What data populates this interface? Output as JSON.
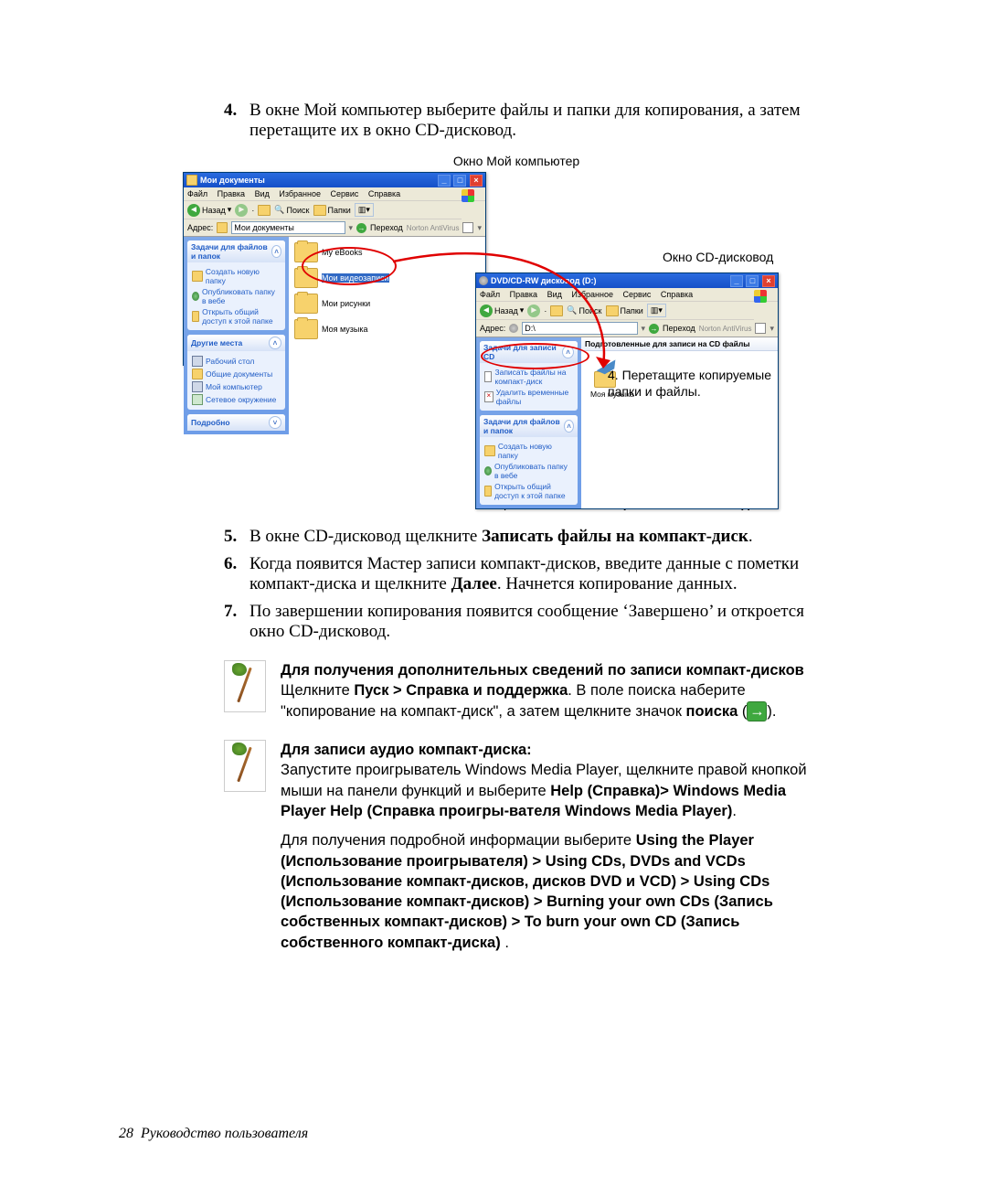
{
  "steps": {
    "s4_num": "4.",
    "s4_text": "В окне Мой компьютер выберите файлы и папки для копирования, а затем перетащите их в окно CD-дисковод.",
    "s5_num": "5.",
    "s5_pre": "В окне CD-дисковод щелкните ",
    "s5_bold": "Записать файлы на компакт-диск",
    "s5_post": ".",
    "s6_num": "6.",
    "s6_pre": "Когда появится Мастер записи компакт-дисков, введите данные с пометки компакт-диска и щелкните ",
    "s6_bold": "Далее",
    "s6_post": ". Начнется копирование данных.",
    "s7_num": "7.",
    "s7_text": "По завершении копирования появится сообщение ‘Завершено’ и откроется окно CD-дисковод."
  },
  "captions": {
    "my_computer": "Окно Мой компьютер",
    "cd_drive": "Окно CD-дисковод",
    "step5a": "5. Щелкните ",
    "step5b": "Записать файлы на компакт-диск",
    "step5c": ".",
    "annot4a": "4. Перетащите копируемые",
    "annot4b": "папки и файлы."
  },
  "xp_common": {
    "menu": {
      "file": "Файл",
      "edit": "Правка",
      "view": "Вид",
      "fav": "Избранное",
      "tools": "Сервис",
      "help": "Справка"
    },
    "tb": {
      "back": "Назад",
      "search": "Поиск",
      "folders": "Папки"
    },
    "addr_label": "Адрес:",
    "go": "Переход",
    "norton": "Norton AntiVirus"
  },
  "win_my": {
    "title": "Мои документы",
    "addr_value": "Мои документы",
    "pane1_title": "Задачи для файлов и папок",
    "pane1_items": [
      "Создать новую папку",
      "Опубликовать папку в вебе",
      "Открыть общий доступ к этой папке"
    ],
    "pane2_title": "Другие места",
    "pane2_items": [
      "Рабочий стол",
      "Общие документы",
      "Мой компьютер",
      "Сетевое окружение"
    ],
    "pane3_title": "Подробно",
    "folders": [
      "My eBooks",
      "Мои видеозаписи",
      "Мои рисунки",
      "Моя музыка"
    ]
  },
  "win_cd": {
    "title": "DVD/CD-RW дисковод (D:)",
    "addr_value": "D:\\",
    "group_header": "Подготовленные для записи на CD файлы",
    "pane_cd_title": "Задачи для записи CD",
    "pane_cd_items": [
      "Записать файлы на компакт-диск",
      "Удалить временные файлы"
    ],
    "pane_fp_title": "Задачи для файлов и папок",
    "pane_fp_items": [
      "Создать новую папку",
      "Опубликовать папку в вебе",
      "Открыть общий доступ к этой папке"
    ],
    "drop_folder_label": "Моя музыка"
  },
  "notes": {
    "n1_title": "Для получения дополнительных сведений по записи компакт-дисков",
    "n1_a": "Щелкните ",
    "n1_b": "Пуск > Справка и поддержка",
    "n1_c": ". В поле поиска наберите \"копирование на компакт-диск\", а затем щелкните значок ",
    "n1_d": "поиска",
    "n1_e": " (",
    "n1_f": ").",
    "n2_title": "Для записи аудио компакт-диска:",
    "n2_a": "Запустите проигрыватель Windows Media Player, щелкните правой кнопкой мыши на панели функций и выберите ",
    "n2_b": "Help (Справка)> Windows Media Player Help (Справка проигры-вателя Windows Media Player)",
    "n2_c": ".",
    "n2_d": "Для получения подробной информации выберите ",
    "n2_e": "Using the Player (Использование проигрывателя) > Using CDs, DVDs and VCDs (Использование компакт-дисков, дисков DVD и VCD) > Using CDs (Использование компакт-дисков) > Burning your own CDs  (Запись собственных компакт-дисков) > To burn your own CD  (Запись собственного компакт-диска)",
    "n2_f": " ."
  },
  "footer": {
    "page": "28",
    "manual": "Руководство пользователя"
  }
}
